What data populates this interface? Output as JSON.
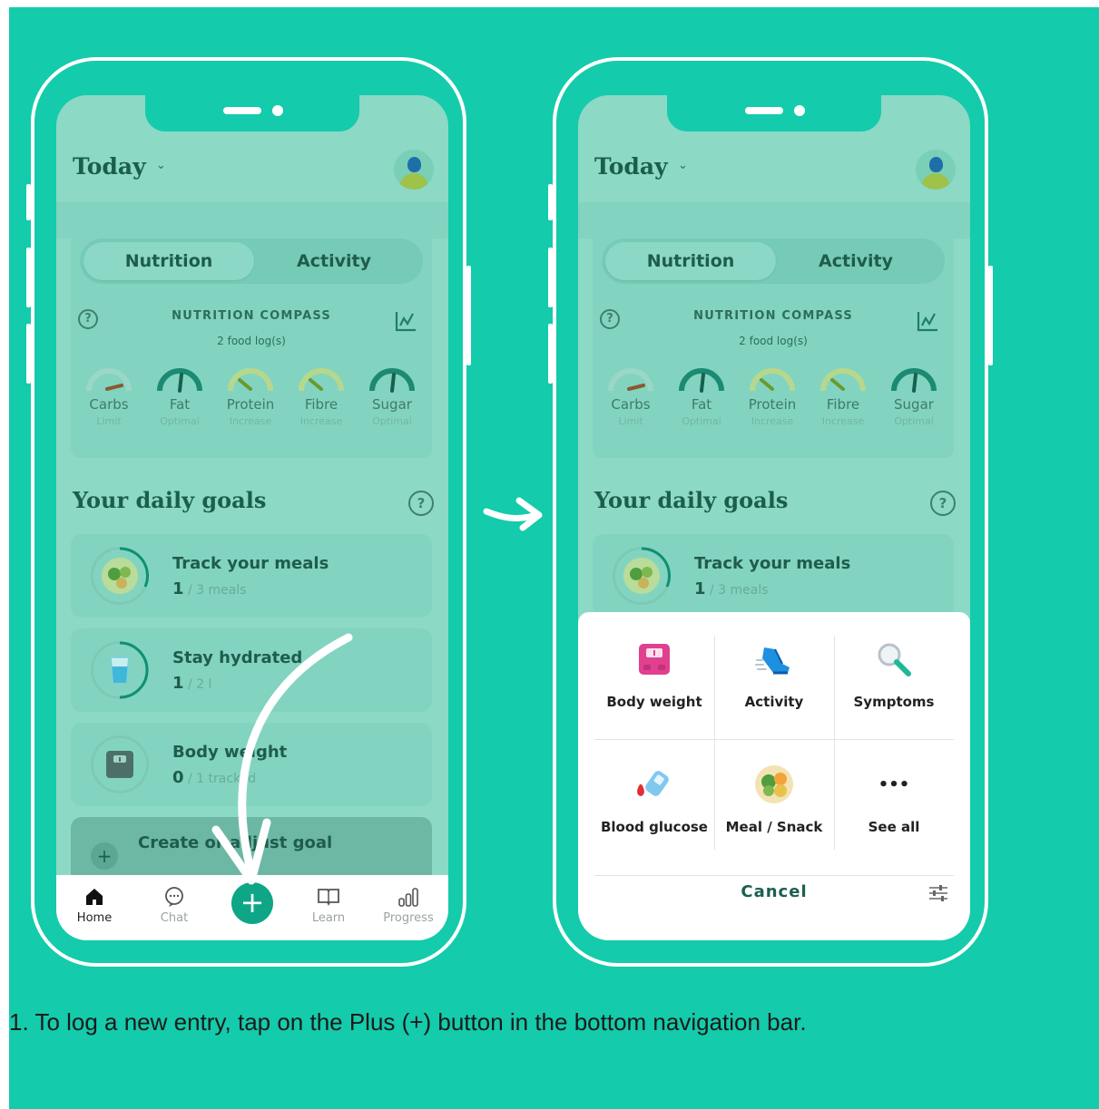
{
  "caption": "1. To log a new entry, tap on the Plus (+) button in the bottom navigation bar.",
  "colors": {
    "background": "#14cbab",
    "accent": "#0ea686",
    "dim_screen": "#8cd9c6",
    "sheet": "#ffffff"
  },
  "header": {
    "title": "Today",
    "chevron_icon": "chevron-down-icon",
    "avatar_icon": "avatar"
  },
  "tabs": {
    "nutrition": "Nutrition",
    "activity": "Activity",
    "selected": "Nutrition"
  },
  "compass": {
    "title": "NUTRITION COMPASS",
    "subtitle": "2 food log(s)",
    "help_icon": "question-icon",
    "chart_icon": "chart-icon",
    "gauges": [
      {
        "name": "Carbs",
        "status": "Limit"
      },
      {
        "name": "Fat",
        "status": "Optimal"
      },
      {
        "name": "Protein",
        "status": "Increase"
      },
      {
        "name": "Fibre",
        "status": "Increase"
      },
      {
        "name": "Sugar",
        "status": "Optimal"
      }
    ]
  },
  "goals": {
    "title": "Your daily goals",
    "items": [
      {
        "title": "Track your meals",
        "value": "1",
        "unit": " / 3 meals",
        "icon": "meal-plate-icon"
      },
      {
        "title": "Stay hydrated",
        "value": "1",
        "unit": " / 2 l",
        "icon": "water-glass-icon"
      },
      {
        "title": "Body weight",
        "value": "0",
        "unit": " / 1 tracked",
        "icon": "scale-icon"
      }
    ],
    "create_label": "Create or adjust goal"
  },
  "nav": {
    "home": "Home",
    "chat": "Chat",
    "add": "+",
    "learn": "Learn",
    "progress": "Progress",
    "active": "Home"
  },
  "entry_sheet": {
    "items": [
      {
        "label": "Body weight",
        "icon": "scale-icon"
      },
      {
        "label": "Activity",
        "icon": "sneaker-icon"
      },
      {
        "label": "Symptoms",
        "icon": "magnifier-icon"
      },
      {
        "label": "Blood glucose",
        "icon": "glucose-meter-icon"
      },
      {
        "label": "Meal / Snack",
        "icon": "meal-plate-icon"
      },
      {
        "label": "See all",
        "icon": "more-dots-icon"
      }
    ],
    "more_dots": "•••",
    "cancel_label": "Cancel",
    "settings_icon": "sliders-icon"
  }
}
